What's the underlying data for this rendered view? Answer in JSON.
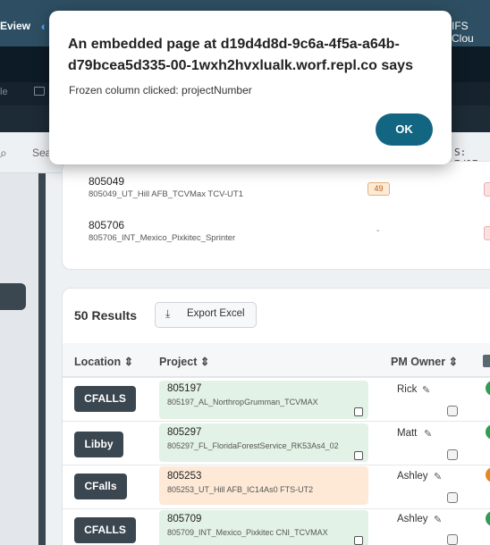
{
  "browser": {
    "left_tab": "Eview",
    "right_tab": "IFS Clou"
  },
  "app": {
    "toolbar_partial": "le",
    "search_partial": "Search p",
    "status_partial": "S: 7/17"
  },
  "top_card": {
    "rows": [
      {
        "number": "805049",
        "name": "805049_UT_Hill AFB_TCVMax TCV-UT1",
        "badge": "49"
      },
      {
        "number": "805706",
        "name": "805706_INT_Mexico_Pixkitec_Sprinter",
        "badge": "-"
      }
    ]
  },
  "results": {
    "count_label": "50 Results",
    "export_label": "Export Excel"
  },
  "table": {
    "headers": {
      "location": "Location",
      "project": "Project",
      "owner": "PM Owner",
      "sort_glyph": "⇕"
    },
    "rows": [
      {
        "location": "CFALLS",
        "number": "805197",
        "name": "805197_AL_NorthropGrumman_TCVMAX",
        "owner": "Rick",
        "project_color": "#e3f2e6",
        "status_color": "#2e9e52"
      },
      {
        "location": "Libby",
        "number": "805297",
        "name": "805297_FL_FloridaForestService_RK53As4_02",
        "owner": "Matt",
        "project_color": "#e3f2e6",
        "status_color": "#2e9e52"
      },
      {
        "location": "CFalls",
        "number": "805253",
        "name": "805253_UT_Hill AFB_IC14As0 FTS-UT2",
        "owner": "Ashley",
        "project_color": "#fde9d6",
        "status_color": "#e08a1e"
      },
      {
        "location": "CFALLS",
        "number": "805709",
        "name": "805709_INT_Mexico_Pixkitec CNI_TCVMAX",
        "owner": "Ashley",
        "project_color": "#e3f2e6",
        "status_color": "#2e9e52"
      }
    ]
  },
  "dialog": {
    "title": "An embedded page at d19d4d8d-9c6a-4f5a-a64b-d79bcea5d335-00-1wxh2hvxlualk.worf.repl.co says",
    "message": "Frozen column clicked: projectNumber",
    "ok_label": "OK"
  }
}
